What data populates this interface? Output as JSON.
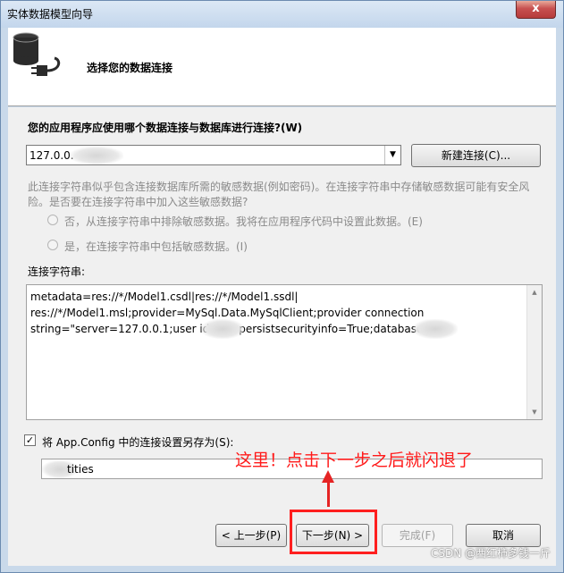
{
  "window": {
    "title": "实体数据模型向导",
    "close_glyph": "x"
  },
  "header": {
    "title": "选择您的数据连接"
  },
  "connection": {
    "question": "您的应用程序应使用哪个数据连接与数据库进行连接?(W)",
    "selected": "127.0.0.",
    "new_button": "新建连接(C)..."
  },
  "sensitive": {
    "desc_line1": "此连接字符串似乎包含连接数据库所需的敏感数据(例如密码)。在连接字符串中存储敏感数据可能有安全风",
    "desc_line2": "险。是否要在连接字符串中加入这些敏感数据?",
    "option_no": "否，从连接字符串中排除敏感数据。我将在应用程序代码中设置此数据。(E)",
    "option_yes": "是，在连接字符串中包括敏感数据。(I)"
  },
  "conn_string": {
    "label": "连接字符串:",
    "value": "metadata=res://*/Model1.csdl|res://*/Model1.ssdl|\nres://*/Model1.msl;provider=MySql.Data.MySqlClient;provider connection\nstring=\"server=127.0.0.1;user id=      persistsecurityinfo=True;database="
  },
  "save": {
    "checkbox_mark": "✓",
    "label": "将 App.Config 中的连接设置另存为(S):",
    "value": "tities"
  },
  "annotation": {
    "text": "这里！点击下一步之后就闪退了"
  },
  "buttons": {
    "back": "< 上一步(P)",
    "next": "下一步(N) >",
    "finish": "完成(F)",
    "cancel": "取消"
  },
  "watermark": "CSDN @西红柿多钱一斤",
  "colors": {
    "annotation": "#ff1a1a",
    "highlight_box": "#ff1f1f"
  }
}
